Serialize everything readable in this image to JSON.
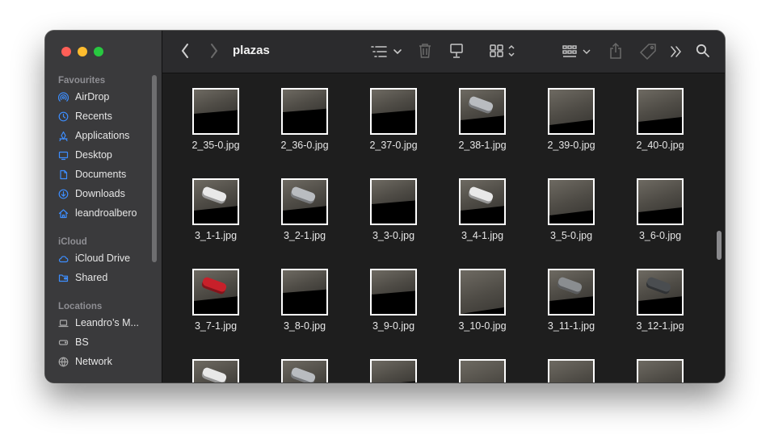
{
  "window": {
    "title": "plazas"
  },
  "colors": {
    "close": "#ff5f57",
    "minimize": "#febc2e",
    "zoom": "#28c840",
    "accent": "#3d8eff"
  },
  "sidebar": {
    "favourites_label": "Favourites",
    "favourites": [
      {
        "label": "AirDrop",
        "icon": "airdrop-icon"
      },
      {
        "label": "Recents",
        "icon": "clock-icon"
      },
      {
        "label": "Applications",
        "icon": "applications-icon"
      },
      {
        "label": "Desktop",
        "icon": "desktop-icon"
      },
      {
        "label": "Documents",
        "icon": "document-icon"
      },
      {
        "label": "Downloads",
        "icon": "download-icon"
      },
      {
        "label": "leandroalbero",
        "icon": "home-icon"
      }
    ],
    "icloud_label": "iCloud",
    "icloud": [
      {
        "label": "iCloud Drive",
        "icon": "cloud-icon"
      },
      {
        "label": "Shared",
        "icon": "shared-folder-icon"
      }
    ],
    "locations_label": "Locations",
    "locations": [
      {
        "label": "Leandro’s M...",
        "icon": "laptop-icon"
      },
      {
        "label": "BS",
        "icon": "drive-icon"
      },
      {
        "label": "Network",
        "icon": "globe-icon"
      }
    ]
  },
  "files": [
    {
      "name": "2_35-0.jpg",
      "kind": "empty"
    },
    {
      "name": "2_36-0.jpg",
      "kind": "empty"
    },
    {
      "name": "2_37-0.jpg",
      "kind": "empty"
    },
    {
      "name": "2_38-1.jpg",
      "kind": "car-silver"
    },
    {
      "name": "2_39-0.jpg",
      "kind": "empty"
    },
    {
      "name": "2_40-0.jpg",
      "kind": "empty"
    },
    {
      "name": "3_1-1.jpg",
      "kind": "car-white"
    },
    {
      "name": "3_2-1.jpg",
      "kind": "car-silver"
    },
    {
      "name": "3_3-0.jpg",
      "kind": "empty"
    },
    {
      "name": "3_4-1.jpg",
      "kind": "car-white"
    },
    {
      "name": "3_5-0.jpg",
      "kind": "empty"
    },
    {
      "name": "3_6-0.jpg",
      "kind": "empty"
    },
    {
      "name": "3_7-1.jpg",
      "kind": "car-red"
    },
    {
      "name": "3_8-0.jpg",
      "kind": "empty"
    },
    {
      "name": "3_9-0.jpg",
      "kind": "empty"
    },
    {
      "name": "3_10-0.jpg",
      "kind": "empty"
    },
    {
      "name": "3_11-1.jpg",
      "kind": "car-gray"
    },
    {
      "name": "3_12-1.jpg",
      "kind": "car-dark"
    },
    {
      "name": "",
      "kind": "car-white"
    },
    {
      "name": "",
      "kind": "car-silver"
    },
    {
      "name": "",
      "kind": "empty"
    },
    {
      "name": "",
      "kind": "empty"
    },
    {
      "name": "",
      "kind": "empty"
    },
    {
      "name": "",
      "kind": "empty"
    }
  ]
}
